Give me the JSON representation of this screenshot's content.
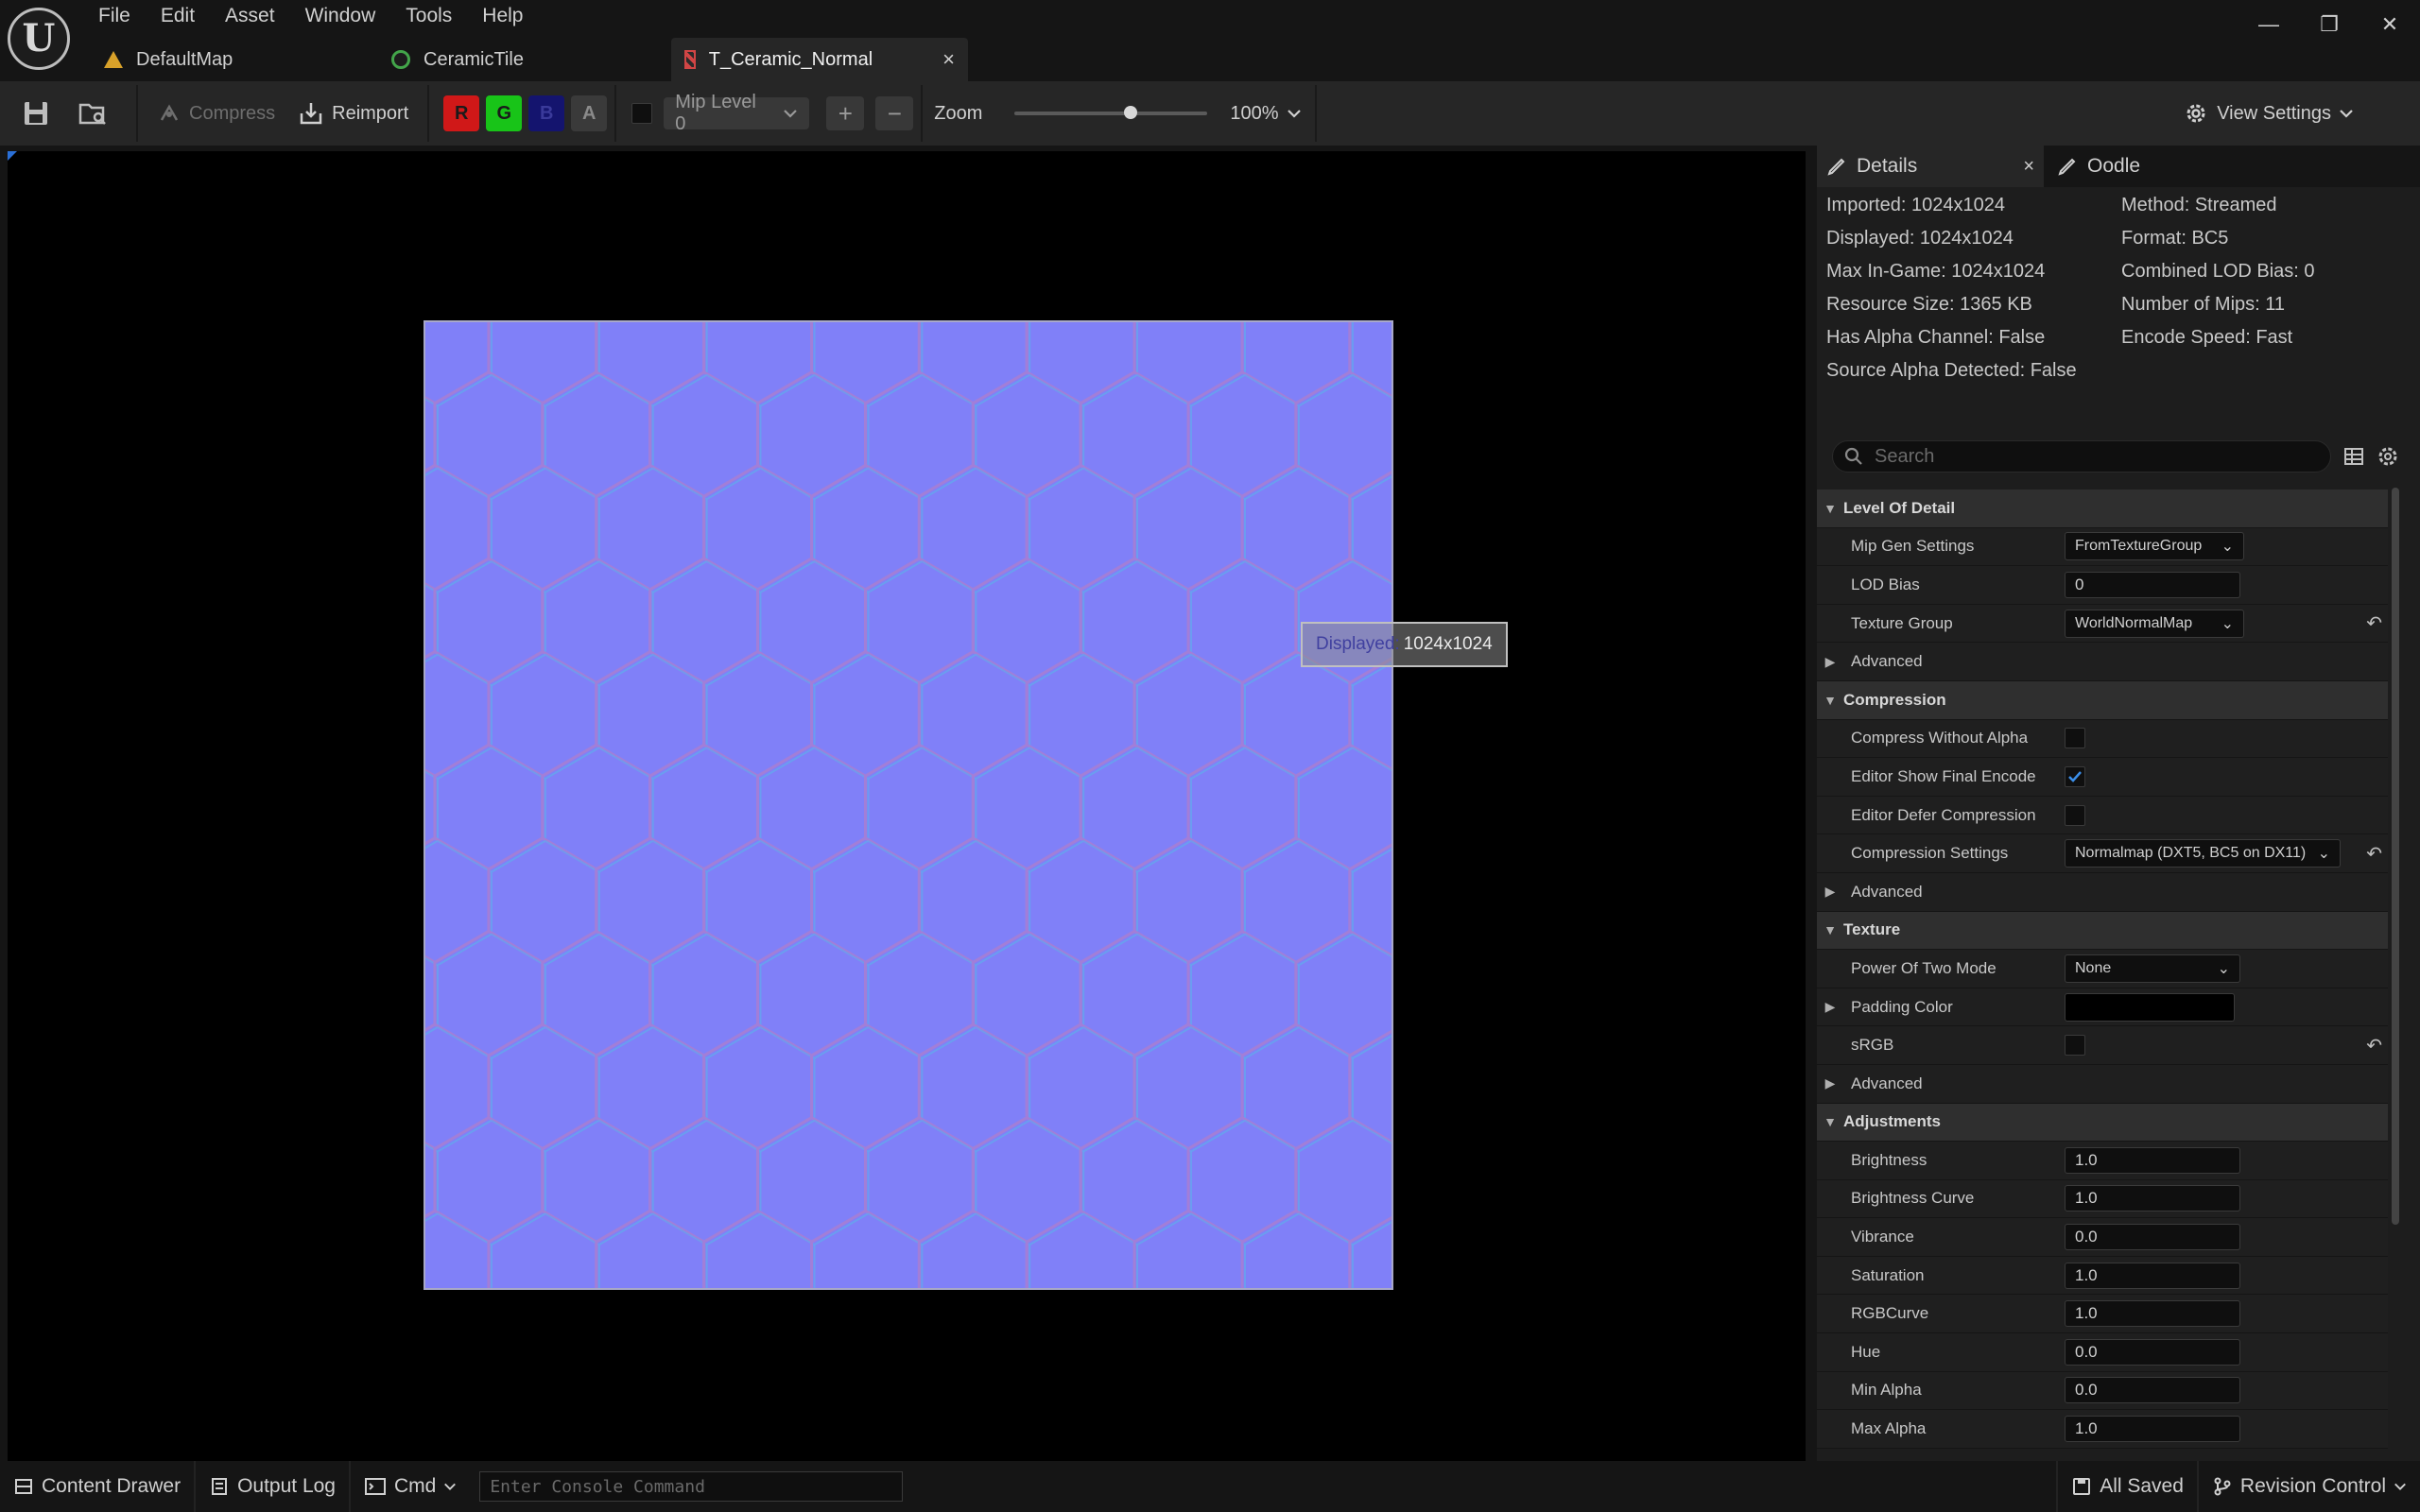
{
  "app": {
    "logo_letter": "U",
    "menu": [
      "File",
      "Edit",
      "Asset",
      "Window",
      "Tools",
      "Help"
    ],
    "window_controls": {
      "minimize": "—",
      "restore": "❐",
      "close": "✕"
    }
  },
  "tabs": [
    {
      "label": "DefaultMap",
      "icon": "map-icon"
    },
    {
      "label": "CeramicTile",
      "icon": "material-icon"
    },
    {
      "label": "T_Ceramic_Normal",
      "icon": "texture-icon",
      "active": true,
      "close": "×"
    }
  ],
  "toolbar": {
    "compress_label": "Compress",
    "reimport_label": "Reimport",
    "channels": [
      "R",
      "G",
      "B",
      "A"
    ],
    "mip_level": "Mip Level 0",
    "plus": "+",
    "minus": "−",
    "zoom_label": "Zoom",
    "zoom_value": "100%",
    "zoom_slider_fraction": 0.6,
    "view_settings_label": "View Settings"
  },
  "viewport": {
    "tooltip_label": "Displayed:",
    "tooltip_value": "1024x1024",
    "texture_color": "#8080f8"
  },
  "details": {
    "tab_label": "Details",
    "tab_close": "×",
    "oodle_tab_label": "Oodle",
    "info_left": [
      "Imported: 1024x1024",
      "Displayed: 1024x1024",
      "Max In-Game: 1024x1024",
      "Resource Size: 1365 KB",
      "Has Alpha Channel: False",
      "Source Alpha Detected: False"
    ],
    "info_right": [
      "Method: Streamed",
      "Format: BC5",
      "Combined LOD Bias: 0",
      "Number of Mips: 11",
      "Encode Speed: Fast"
    ],
    "search_placeholder": "Search",
    "categories": {
      "lod": "Level Of Detail",
      "compression": "Compression",
      "texture": "Texture",
      "adjustments": "Adjustments"
    },
    "advanced_label": "Advanced",
    "props": {
      "mip_gen_settings": {
        "name": "Mip Gen Settings",
        "value": "FromTextureGroup"
      },
      "lod_bias": {
        "name": "LOD Bias",
        "value": "0"
      },
      "texture_group": {
        "name": "Texture Group",
        "value": "WorldNormalMap"
      },
      "compress_without_alpha": {
        "name": "Compress Without Alpha",
        "checked": false
      },
      "editor_show_final_encode": {
        "name": "Editor Show Final Encode",
        "checked": true
      },
      "editor_defer_compression": {
        "name": "Editor Defer Compression",
        "checked": false
      },
      "compression_settings": {
        "name": "Compression Settings",
        "value": "Normalmap (DXT5, BC5 on DX11)"
      },
      "power_of_two_mode": {
        "name": "Power Of Two Mode",
        "value": "None"
      },
      "padding_color": {
        "name": "Padding Color",
        "color": "#000000"
      },
      "srgb": {
        "name": "sRGB",
        "checked": false
      },
      "brightness": {
        "name": "Brightness",
        "value": "1.0"
      },
      "brightness_curve": {
        "name": "Brightness Curve",
        "value": "1.0"
      },
      "vibrance": {
        "name": "Vibrance",
        "value": "0.0"
      },
      "saturation": {
        "name": "Saturation",
        "value": "1.0"
      },
      "rgbcurve": {
        "name": "RGBCurve",
        "value": "1.0"
      },
      "hue": {
        "name": "Hue",
        "value": "0.0"
      },
      "min_alpha": {
        "name": "Min Alpha",
        "value": "0.0"
      },
      "max_alpha": {
        "name": "Max Alpha",
        "value": "1.0"
      }
    }
  },
  "statusbar": {
    "content_drawer": "Content Drawer",
    "output_log": "Output Log",
    "cmd": "Cmd",
    "console_placeholder": "Enter Console Command",
    "all_saved": "All Saved",
    "revision_control": "Revision Control"
  }
}
